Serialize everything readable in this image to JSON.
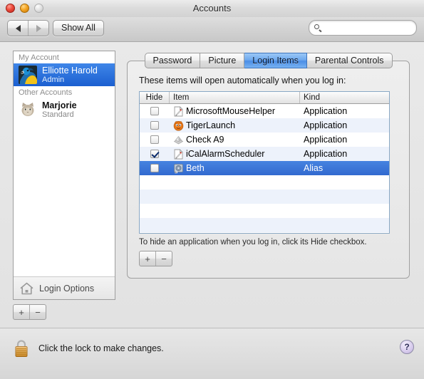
{
  "window": {
    "title": "Accounts",
    "traffic_lights": [
      "close-button",
      "minimize-button",
      "zoom-button"
    ]
  },
  "toolbar": {
    "back_icon": "triangle-left-icon",
    "forward_icon": "triangle-right-icon",
    "show_all_label": "Show All",
    "search": {
      "value": "",
      "placeholder": "",
      "icon": "search-icon"
    }
  },
  "sidebar": {
    "groups": [
      {
        "label": "My Account",
        "accounts": [
          {
            "name": "Elliotte Harold",
            "role": "Admin",
            "selected": true,
            "avatar": "parrot-avatar"
          }
        ]
      },
      {
        "label": "Other Accounts",
        "accounts": [
          {
            "name": "Marjorie",
            "role": "Standard",
            "selected": false,
            "avatar": "cat-avatar"
          }
        ]
      }
    ],
    "login_options_label": "Login Options",
    "login_options_icon": "home-icon",
    "add_label": "+",
    "remove_label": "−"
  },
  "tabs": [
    {
      "label": "Password",
      "active": false
    },
    {
      "label": "Picture",
      "active": false
    },
    {
      "label": "Login Items",
      "active": true
    },
    {
      "label": "Parental Controls",
      "active": false
    }
  ],
  "login_items_pane": {
    "caption": "These items will open automatically when you log in:",
    "columns": [
      "Hide",
      "Item",
      "Kind"
    ],
    "rows": [
      {
        "hide": false,
        "item": "MicrosoftMouseHelper",
        "kind": "Application",
        "icon": "document-app-icon",
        "selected": false
      },
      {
        "hide": false,
        "item": "TigerLaunch",
        "kind": "Application",
        "icon": "orange-face-icon",
        "selected": false
      },
      {
        "hide": false,
        "item": "Check A9",
        "kind": "Application",
        "icon": "silver-app-icon",
        "selected": false
      },
      {
        "hide": true,
        "item": "iCalAlarmScheduler",
        "kind": "Application",
        "icon": "document-app-icon",
        "selected": false
      },
      {
        "hide": false,
        "item": "Beth",
        "kind": "Alias",
        "icon": "alias-disk-icon",
        "selected": true
      }
    ],
    "empty_rows": 5,
    "hint": "To hide an application when you log in, click its Hide checkbox.",
    "add_label": "+",
    "remove_label": "−"
  },
  "bottom": {
    "lock_icon": "locked-padlock-icon",
    "lock_text": "Click the lock to make changes.",
    "help_label": "?"
  },
  "colors": {
    "selection_blue": "#3269cf",
    "tab_active_blue": "#4b8ee6",
    "row_stripe": "#edf2fb",
    "lock_gold": "#e09b2d",
    "help_purple": "#bfb0dd"
  }
}
